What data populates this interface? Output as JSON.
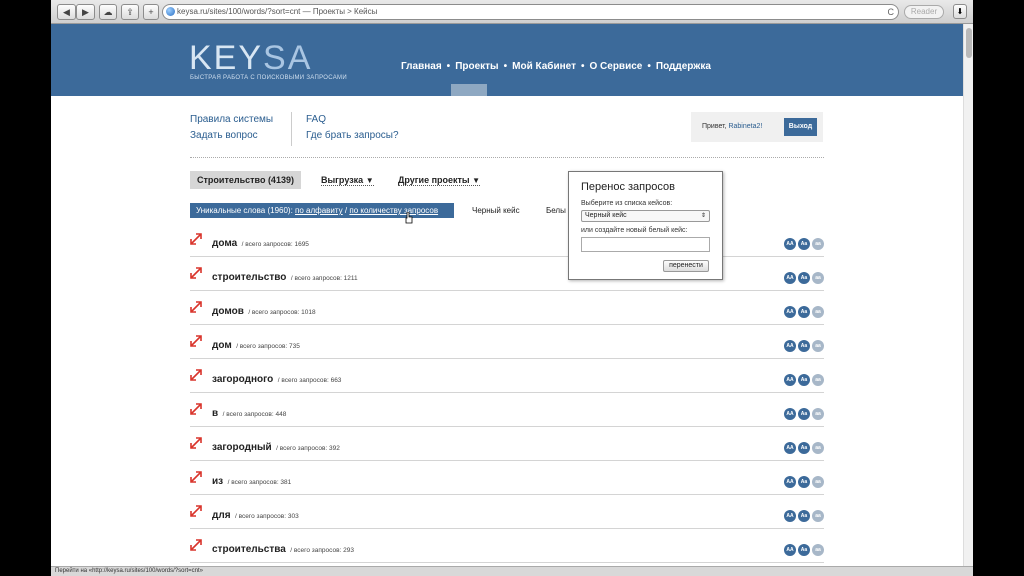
{
  "browser": {
    "back": "◀",
    "forward": "▶",
    "cloud": "☁",
    "share": "⇪",
    "add": "+",
    "address": "keysa.ru/sites/100/words/?sort=cnt — Проекты > Кейсы",
    "reload": "C",
    "reader": "Reader",
    "right_button": "⬇",
    "status": "Перейти на «http://keysa.ru/sites/100/words/?sort=cnt»"
  },
  "header": {
    "logo_key": "KEY",
    "logo_sa": "SA",
    "tagline": "БЫСТРАЯ РАБОТА С ПОИСКОВЫМИ ЗАПРОСАМИ",
    "nav": [
      "Главная",
      "Проекты",
      "Мой Кабинет",
      "О Сервисе",
      "Поддержка"
    ],
    "nav_sep": "•"
  },
  "links": {
    "rules": "Правила системы",
    "ask": "Задать вопрос",
    "faq": "FAQ",
    "where": "Где брать запросы?"
  },
  "user": {
    "greeting": "Привет,",
    "name": "Rabineta2!",
    "logout": "Выход"
  },
  "tabs": {
    "project": "Строительство (4139)",
    "export": "Выгрузка",
    "other": "Другие проекты",
    "triangle": "▼"
  },
  "sortbar": {
    "prefix": "Уникальные слова (1960):",
    "alpha": "по алфавиту",
    "slash": "/",
    "count": "по количеству запросов"
  },
  "cases": {
    "black": "Черный кейс",
    "white": "Белы"
  },
  "rows": [
    {
      "word": "дома",
      "meta": "/ всего запросов: 1695"
    },
    {
      "word": "строительство",
      "meta": "/ всего запросов: 1211"
    },
    {
      "word": "домов",
      "meta": "/ всего запросов: 1018"
    },
    {
      "word": "дом",
      "meta": "/ всего запросов: 735"
    },
    {
      "word": "загородного",
      "meta": "/ всего запросов: 663"
    },
    {
      "word": "в",
      "meta": "/ всего запросов: 448"
    },
    {
      "word": "загородный",
      "meta": "/ всего запросов: 392"
    },
    {
      "word": "из",
      "meta": "/ всего запросов: 381"
    },
    {
      "word": "для",
      "meta": "/ всего запросов: 303"
    },
    {
      "word": "строительства",
      "meta": "/ всего запросов: 293"
    }
  ],
  "case_buttons": [
    "AA",
    "Aa",
    "aa"
  ],
  "popup": {
    "title": "Перенос запросов",
    "label_select": "Выберите из списка кейсов:",
    "selected": "Черный кейс",
    "label_new": "или создайте новый белый кейс:",
    "input_value": "",
    "button": "перенести"
  },
  "colors": {
    "brand": "#3c6a9a",
    "accent_arrow": "#d9342b",
    "link": "#2a5d8f"
  }
}
